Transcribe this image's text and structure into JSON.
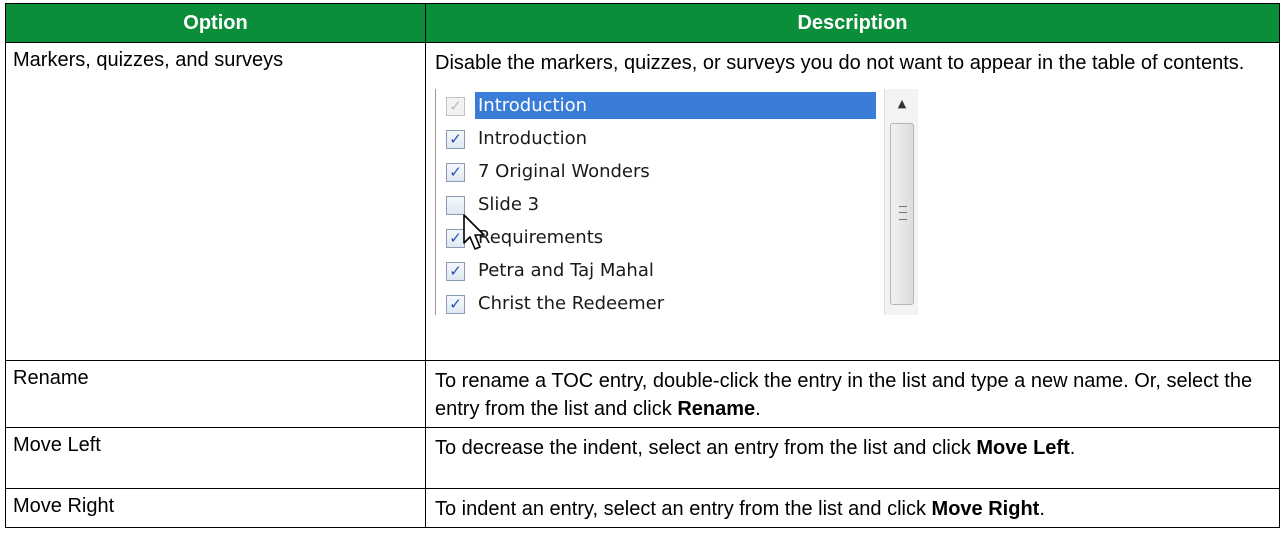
{
  "table": {
    "headers": {
      "option": "Option",
      "description": "Description"
    },
    "rows": [
      {
        "option": "Markers, quizzes, and surveys",
        "description": "Disable the markers, quizzes, or surveys you do not want to appear in the table of contents."
      },
      {
        "option": "Rename",
        "desc_pre": "To rename a TOC entry, double-click the entry in the list and type a new name. Or, select the entry from the list and click ",
        "desc_bold": "Rename",
        "desc_post": "."
      },
      {
        "option": "Move Left",
        "desc_pre": "To decrease the indent, select an entry from the list and click ",
        "desc_bold": "Move Left",
        "desc_post": "."
      },
      {
        "option": "Move Right",
        "desc_pre": "To indent an entry, select an entry from the list and click ",
        "desc_bold": "Move Right",
        "desc_post": "."
      }
    ]
  },
  "toc_list": {
    "items": [
      {
        "label": "Introduction",
        "checked": true,
        "state": "disabled",
        "selected": true
      },
      {
        "label": "Introduction",
        "checked": true,
        "state": "enabled",
        "selected": false
      },
      {
        "label": "7 Original Wonders",
        "checked": true,
        "state": "enabled",
        "selected": false
      },
      {
        "label": "Slide 3",
        "checked": false,
        "state": "enabled",
        "selected": false
      },
      {
        "label": "Requirements",
        "checked": true,
        "state": "enabled",
        "selected": false
      },
      {
        "label": "Petra and Taj Mahal",
        "checked": true,
        "state": "enabled",
        "selected": false
      },
      {
        "label": "Christ the Redeemer",
        "checked": true,
        "state": "enabled",
        "selected": false
      }
    ],
    "check_glyph": "✓",
    "scroll_up_glyph": "▲"
  },
  "colors": {
    "header_bg": "#0b8e3a",
    "selection": "#3a7dd8",
    "check": "#2550b3"
  }
}
